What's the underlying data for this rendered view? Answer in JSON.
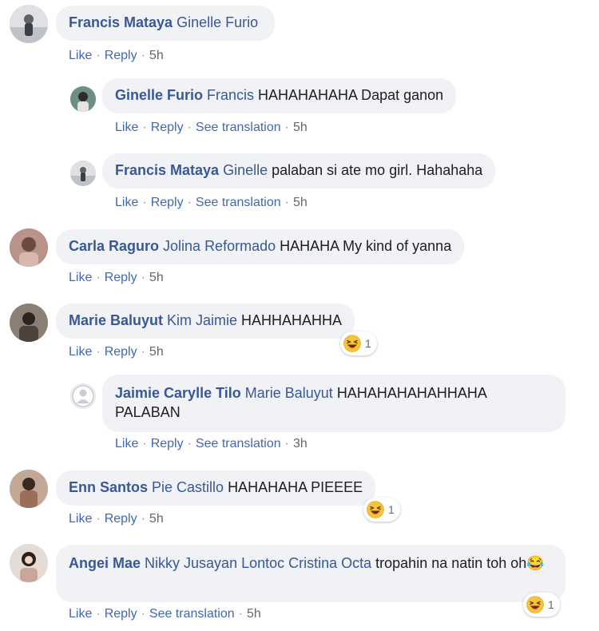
{
  "actions": {
    "like": "Like",
    "reply": "Reply",
    "see_translation": "See translation",
    "separator": "·"
  },
  "reaction_icon": "laughing-emoji-icon",
  "colors": {
    "link": "#385898",
    "action": "#4267b2",
    "bubble": "#f0f2f5",
    "muted": "#65676b"
  },
  "comments": [
    {
      "author": "Francis Mataya",
      "tags": "Ginelle Furio",
      "text": "",
      "time": "5h",
      "avatar_icon": "user-photo-avatar"
    },
    {
      "author": "Ginelle Furio",
      "tags": "Francis",
      "text": "HAHAHAHAHA Dapat ganon",
      "time": "5h",
      "avatar_icon": "user-photo-avatar"
    },
    {
      "author": "Francis Mataya",
      "tags": "Ginelle",
      "text": "palaban si ate mo girl. Hahahaha",
      "time": "5h",
      "avatar_icon": "user-photo-avatar"
    },
    {
      "author": "Carla Raguro",
      "tags": "Jolina Reformado",
      "text": "HAHAHA My kind of yanna",
      "time": "5h",
      "avatar_icon": "user-photo-avatar"
    },
    {
      "author": "Marie Baluyut",
      "tags": "Kim Jaimie",
      "text": "HAHHAHAHHA",
      "time": "5h",
      "reactions": "1",
      "avatar_icon": "user-photo-avatar"
    },
    {
      "author": "Jaimie Carylle Tilo",
      "tags": "Marie Baluyut",
      "text": "HAHAHAHAHAHHAHA PALABAN",
      "time": "3h",
      "avatar_icon": "default-user-avatar"
    },
    {
      "author": "Enn Santos",
      "tags": "Pie Castillo",
      "text": "HAHAHAHA PIEEEE",
      "time": "5h",
      "reactions": "1",
      "avatar_icon": "user-photo-avatar"
    },
    {
      "author": "Angei Mae",
      "tags": "Nikky Jusayan Lontoc Cristina Octa",
      "text": "tropahin na natin toh oh😂",
      "time": "5h",
      "reactions": "1",
      "avatar_icon": "user-photo-avatar"
    }
  ]
}
